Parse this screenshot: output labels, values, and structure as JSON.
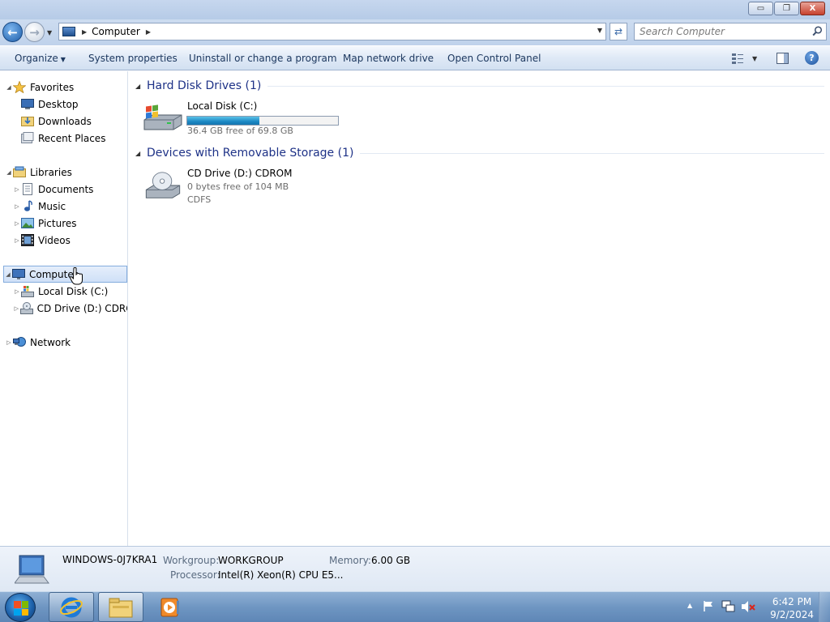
{
  "window": {
    "min_glyph": "▭",
    "restore_glyph": "❐",
    "close_glyph": "X"
  },
  "address": {
    "path_item": "Computer",
    "search_placeholder": "Search Computer"
  },
  "commandbar": {
    "organize": "Organize",
    "system_properties": "System properties",
    "uninstall": "Uninstall or change a program",
    "map_drive": "Map network drive",
    "control_panel": "Open Control Panel"
  },
  "sidebar": {
    "favorites": "Favorites",
    "desktop": "Desktop",
    "downloads": "Downloads",
    "recent_places": "Recent Places",
    "libraries": "Libraries",
    "documents": "Documents",
    "music": "Music",
    "pictures": "Pictures",
    "videos": "Videos",
    "computer": "Computer",
    "local_disk": "Local Disk (C:)",
    "cd_drive": "CD Drive (D:) CDROM",
    "network": "Network"
  },
  "content": {
    "hdd_group": "Hard Disk Drives (1)",
    "removable_group": "Devices with Removable Storage (1)",
    "drive_c": {
      "name": "Local Disk (C:)",
      "free_text": "36.4 GB free of 69.8 GB",
      "used_fraction": 0.48
    },
    "drive_d": {
      "name": "CD Drive (D:) CDROM",
      "free_text": "0 bytes free of 104 MB",
      "fs": "CDFS"
    }
  },
  "details": {
    "computer_name": "WINDOWS-0J7KRA1",
    "workgroup_label": "Workgroup:",
    "workgroup_value": "WORKGROUP",
    "memory_label": "Memory:",
    "memory_value": "6.00 GB",
    "processor_label": "Processor:",
    "processor_value": "Intel(R) Xeon(R) CPU E5..."
  },
  "taskbar": {
    "time": "6:42 PM",
    "date": "9/2/2024"
  },
  "colors": {
    "accent": "#1e3287",
    "progress": "#1c88c4",
    "selection": "#cfe0f7"
  }
}
